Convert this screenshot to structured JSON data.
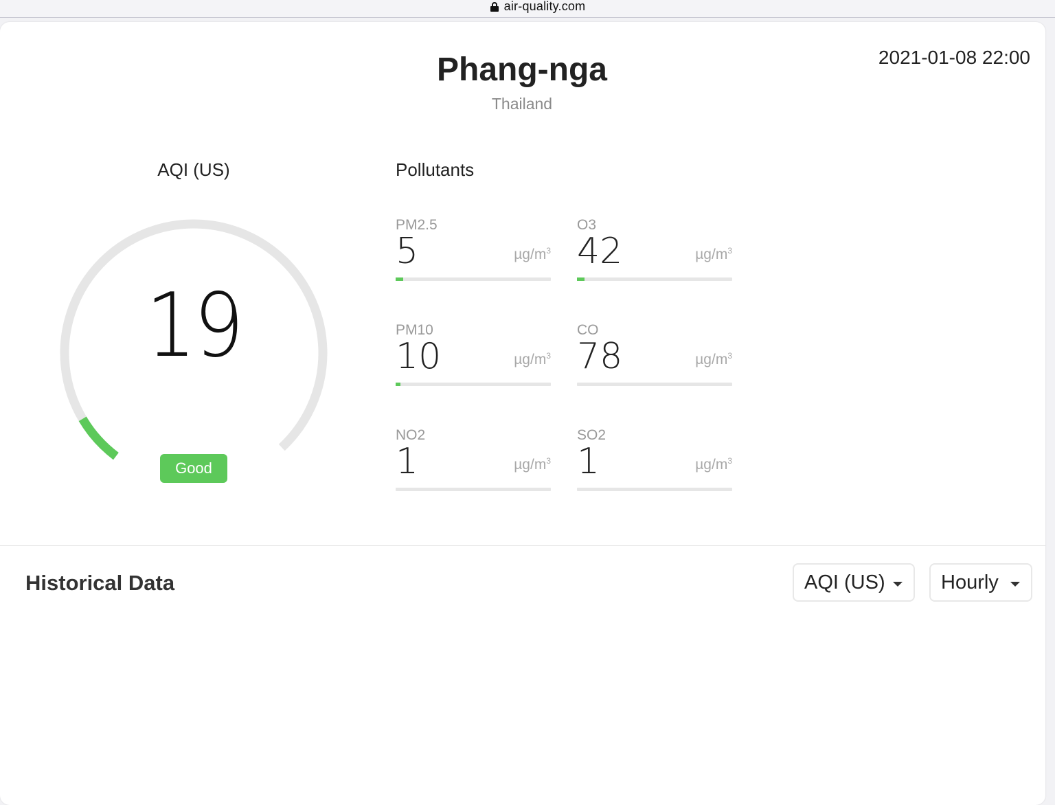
{
  "browser": {
    "url": "air-quality.com"
  },
  "header": {
    "city": "Phang-nga",
    "country": "Thailand",
    "timestamp": "2021-01-08 22:00"
  },
  "aqi": {
    "title": "AQI (US)",
    "value": "19",
    "max": 500,
    "category": "Good",
    "colors": {
      "good": "#5dc95a",
      "track": "#e6e6e6"
    }
  },
  "pollutants": {
    "title": "Pollutants",
    "unit_base": "µg/m",
    "unit_exp": "3",
    "items": [
      {
        "name": "PM2.5",
        "value": "5",
        "level": 0.05
      },
      {
        "name": "O3",
        "value": "42",
        "level": 0.05
      },
      {
        "name": "PM10",
        "value": "10",
        "level": 0.03
      },
      {
        "name": "CO",
        "value": "78",
        "level": 0.0
      },
      {
        "name": "NO2",
        "value": "1",
        "level": 0.0
      },
      {
        "name": "SO2",
        "value": "1",
        "level": 0.0
      }
    ]
  },
  "historical": {
    "title": "Historical Data",
    "metric_select": "AQI (US)",
    "period_select": "Hourly"
  }
}
